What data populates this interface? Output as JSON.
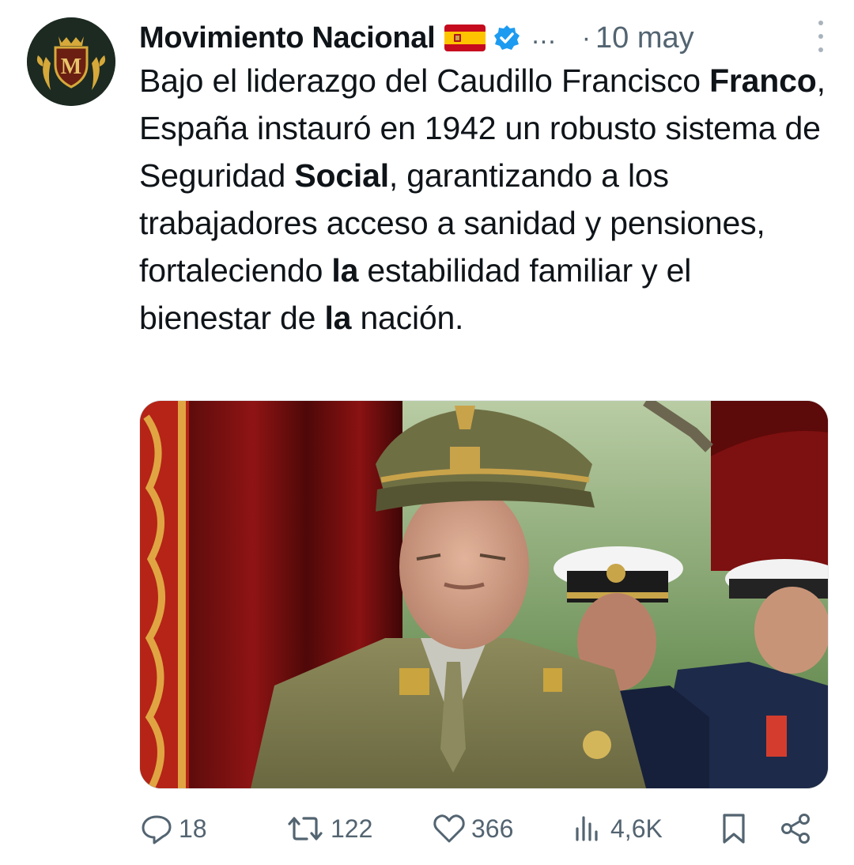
{
  "tweet": {
    "author_name": "Movimiento Nacional",
    "flag_icon": "spain-flag-emoji",
    "verified_icon": "verified-badge-icon",
    "ellipsis": "...",
    "separator": "·",
    "date": "10 may",
    "text_segments": [
      {
        "text": "Bajo el liderazgo del Caudillo Francisco ",
        "bold": false
      },
      {
        "text": "Franco",
        "bold": true
      },
      {
        "text": ", España instauró en 1942 un robusto sistema de Seguridad ",
        "bold": false
      },
      {
        "text": "Social",
        "bold": true
      },
      {
        "text": ", garantizando a los trabajadores acceso a sanidad y pensiones, fortaleciendo ",
        "bold": false
      },
      {
        "text": "la",
        "bold": true
      },
      {
        "text": " estabilidad familiar y el bienestar de ",
        "bold": false
      },
      {
        "text": "la",
        "bold": true
      },
      {
        "text": " nación.",
        "bold": false
      }
    ],
    "avatar_letter": "M"
  },
  "actions": {
    "reply": {
      "icon": "reply-icon",
      "count": "18"
    },
    "retweet": {
      "icon": "retweet-icon",
      "count": "122"
    },
    "like": {
      "icon": "heart-icon",
      "count": "366"
    },
    "views": {
      "icon": "views-chart-icon",
      "count": "4,6K"
    },
    "bookmark": {
      "icon": "bookmark-icon"
    },
    "share": {
      "icon": "share-icon"
    }
  },
  "colors": {
    "text": "#0f1419",
    "muted": "#536471",
    "verified_blue": "#1d9bf0",
    "avatar_bg": "#1c2a22",
    "avatar_gold": "#d6a93a"
  }
}
